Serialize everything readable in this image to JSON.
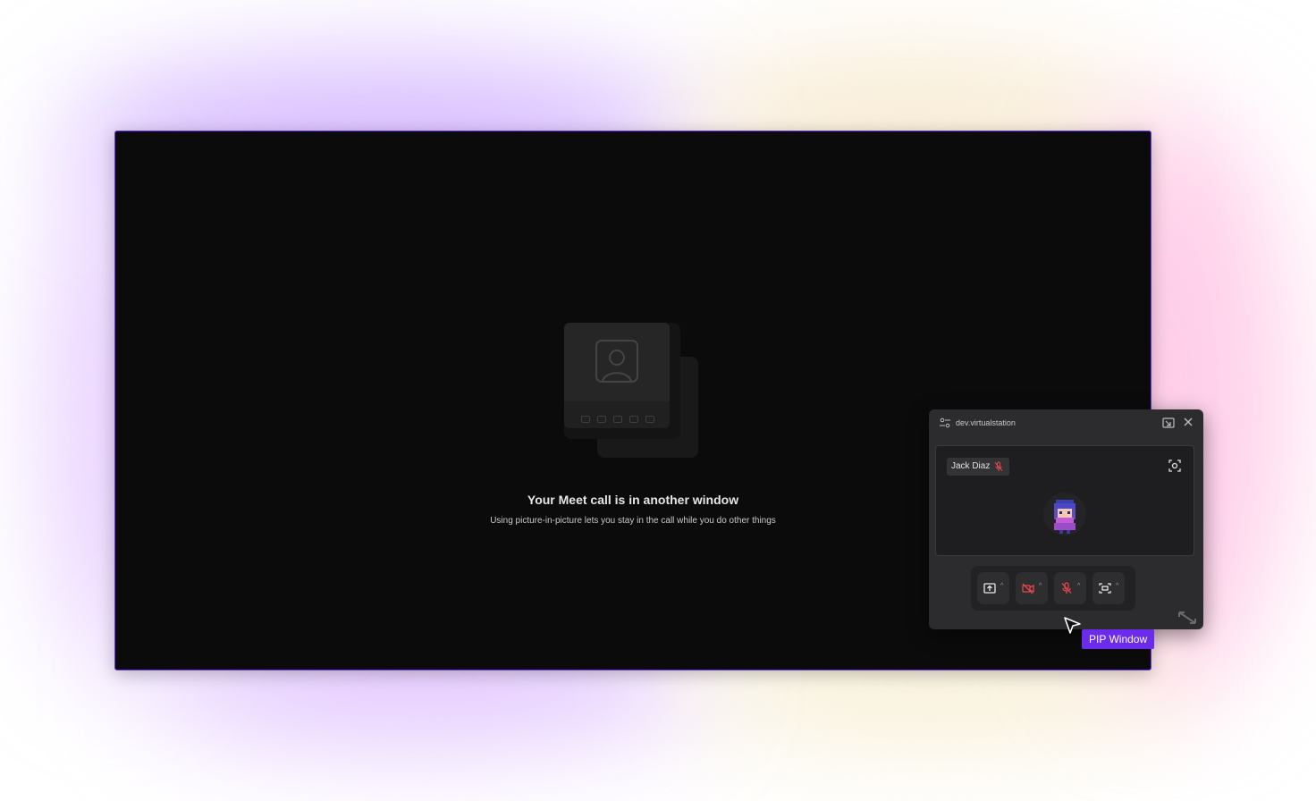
{
  "main": {
    "title": "Your Meet call is in another window",
    "subtitle": "Using picture-in-picture lets you stay in the call while you do other things"
  },
  "pip": {
    "url": "dev.virtualstation",
    "participant": {
      "name": "Jack Diaz",
      "muted": true
    },
    "controls": [
      {
        "icon": "share-screen-icon",
        "state": "on"
      },
      {
        "icon": "camera-off-icon",
        "state": "off"
      },
      {
        "icon": "mic-off-icon",
        "state": "off"
      },
      {
        "icon": "focus-frame-icon",
        "state": "on"
      }
    ]
  },
  "annotation": {
    "label": "PIP Window"
  },
  "colors": {
    "accent": "#6b2bea",
    "muted_red": "#e5484d",
    "screen_bg": "#0b0b0b",
    "pip_bg": "#2c2c2e"
  }
}
